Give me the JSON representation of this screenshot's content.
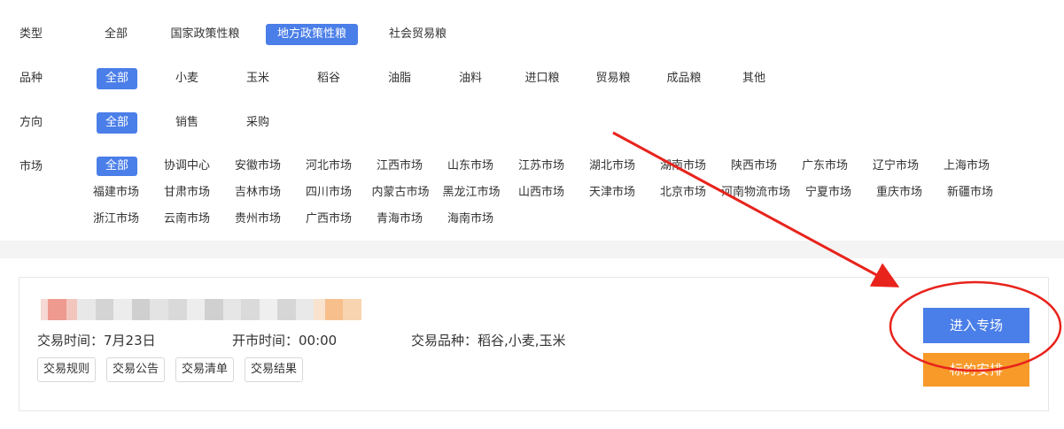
{
  "filters": {
    "type": {
      "label": "类型",
      "options": [
        "全部",
        "国家政策性粮",
        "地方政策性粮",
        "社会贸易粮"
      ],
      "active": "地方政策性粮"
    },
    "variety": {
      "label": "品种",
      "options": [
        "全部",
        "小麦",
        "玉米",
        "稻谷",
        "油脂",
        "油料",
        "进口粮",
        "贸易粮",
        "成品粮",
        "其他"
      ],
      "active": "全部"
    },
    "direction": {
      "label": "方向",
      "options": [
        "全部",
        "销售",
        "采购"
      ],
      "active": "全部"
    },
    "market": {
      "label": "市场",
      "options": [
        "全部",
        "协调中心",
        "安徽市场",
        "河北市场",
        "江西市场",
        "山东市场",
        "江苏市场",
        "湖北市场",
        "湖南市场",
        "陕西市场",
        "广东市场",
        "辽宁市场",
        "上海市场",
        "福建市场",
        "甘肃市场",
        "吉林市场",
        "四川市场",
        "内蒙古市场",
        "黑龙江市场",
        "山西市场",
        "天津市场",
        "北京市场",
        "河南物流市场",
        "宁夏市场",
        "重庆市场",
        "新疆市场",
        "浙江市场",
        "云南市场",
        "贵州市场",
        "广西市场",
        "青海市场",
        "海南市场"
      ],
      "active": "全部"
    }
  },
  "listing": {
    "trade_time": "交易时间：7月23日",
    "open_time": "开市时间：00:00",
    "trade_variety": "交易品种：稻谷,小麦,玉米",
    "tags": [
      "交易规则",
      "交易公告",
      "交易清单",
      "交易结果"
    ],
    "enter_button": "进入专场",
    "schedule_button": "标的安排"
  },
  "colors": {
    "accent": "#4a7ee8",
    "orange": "#f79a29",
    "annotation_red": "#e8231c"
  }
}
